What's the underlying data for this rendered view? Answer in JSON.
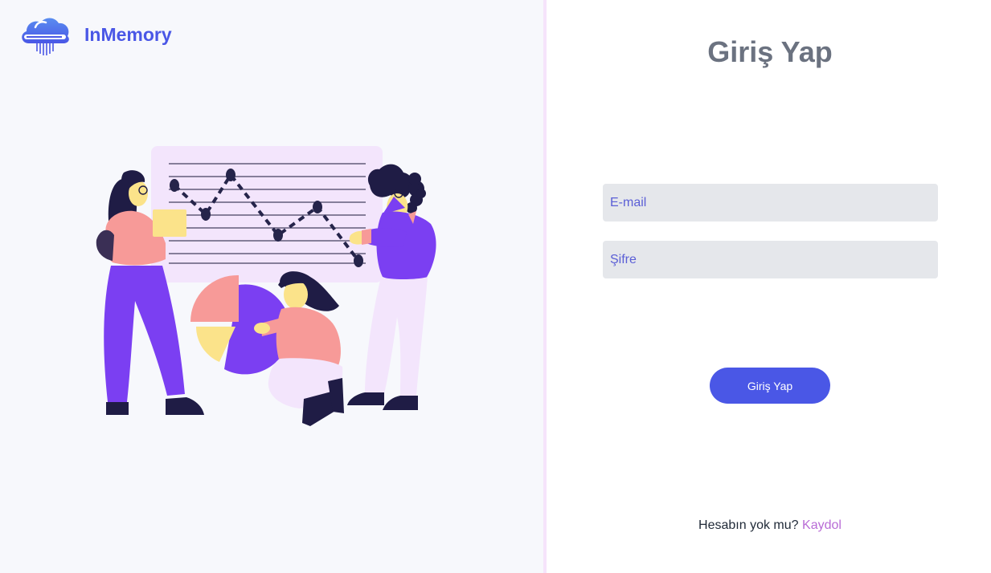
{
  "brand": {
    "name": "InMemory",
    "logo_icon": "cloud-memory-icon"
  },
  "illustration": {
    "icon": "team-data-analysis-illustration"
  },
  "login_form": {
    "title": "Giriş Yap",
    "email": {
      "placeholder": "E-mail",
      "value": ""
    },
    "password": {
      "placeholder": "Şifre",
      "value": ""
    },
    "submit_label": "Giriş Yap",
    "signup_prompt": "Hesabın yok mu?",
    "signup_link": "Kaydol"
  },
  "colors": {
    "brand": "#4a57e6",
    "link": "#b86bd6",
    "left_background": "#f7f8fc",
    "input_background": "#e5e7eb",
    "title": "#6b7280"
  }
}
